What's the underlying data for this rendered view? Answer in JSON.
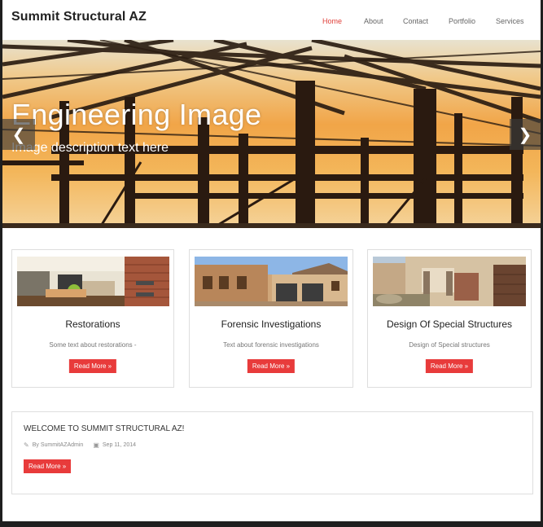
{
  "site": {
    "brand": "Summit Structural AZ"
  },
  "nav": [
    {
      "label": "Home",
      "active": true
    },
    {
      "label": "About",
      "active": false
    },
    {
      "label": "Contact",
      "active": false
    },
    {
      "label": "Portfolio",
      "active": false
    },
    {
      "label": "Services",
      "active": false
    }
  ],
  "hero": {
    "title": "Engineering Image",
    "description": "Image description text here",
    "prev_icon": "chevron-left-icon",
    "next_icon": "chevron-right-icon"
  },
  "cards": [
    {
      "title": "Restorations",
      "text": "Some text about restorations -",
      "button": "Read More »"
    },
    {
      "title": "Forensic Investigations",
      "text": "Text about forensic investigations",
      "button": "Read More »"
    },
    {
      "title": "Design Of Special Structures",
      "text": "Design of Special structures",
      "button": "Read More »"
    }
  ],
  "post": {
    "title": "WELCOME TO SUMMIT STRUCTURAL AZ!",
    "author": "By SummitAZAdmin",
    "date": "Sep 11, 2014",
    "button": "Read More »"
  },
  "colors": {
    "accent": "#e83b3b",
    "nav_active": "#e0403a"
  }
}
